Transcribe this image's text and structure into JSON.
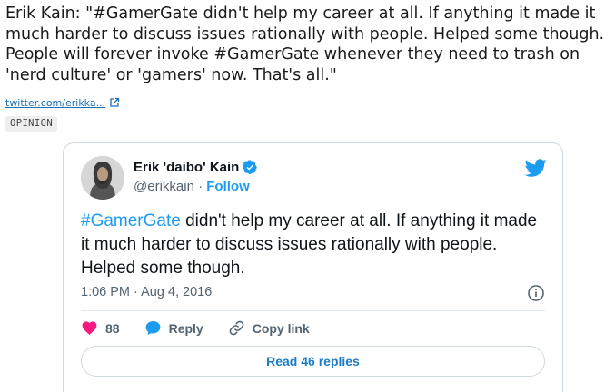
{
  "article": {
    "quote": "Erik Kain: \"#GamerGate didn't help my career at all. If anything it made it much harder to discuss issues rationally with people. Helped some though. People will forever invoke #GamerGate whenever they need to trash on 'nerd culture' or 'gamers' now. That's all.\"",
    "source_link": "twitter.com/erikka...",
    "badge": "OPINION"
  },
  "tweet": {
    "display_name": "Erik 'daibo' Kain",
    "handle": "@erikkain",
    "separator": "·",
    "follow_label": "Follow",
    "text_hashtag": "#GamerGate",
    "text_rest": " didn't help my career at all. If anything it made it much harder to discuss issues rationally with people. Helped some though.",
    "timestamp": "1:06 PM · Aug 4, 2016",
    "like_count": "88",
    "reply_label": "Reply",
    "copy_link_label": "Copy link",
    "read_replies_label": "Read 46 replies"
  },
  "icons": {
    "external": "external-link-icon",
    "verified": "verified-badge-icon",
    "bird": "twitter-bird-icon",
    "info": "info-icon",
    "heart": "heart-icon",
    "reply": "reply-bubble-icon",
    "link": "link-icon"
  },
  "colors": {
    "accent": "#1d9bf0",
    "heart": "#f91880",
    "link": "#1a6fb5"
  }
}
